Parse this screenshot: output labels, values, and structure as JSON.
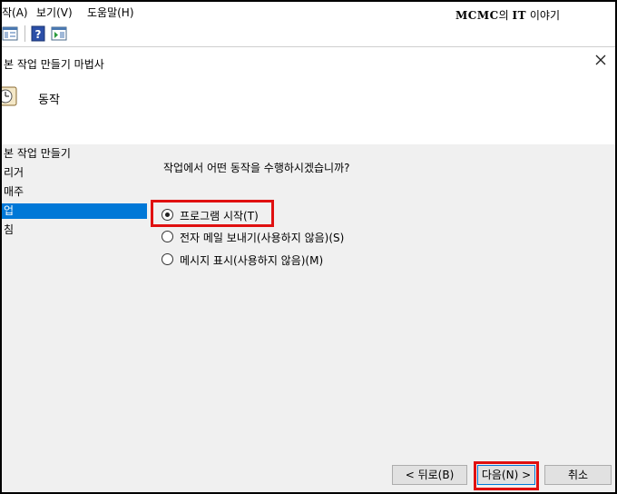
{
  "menubar": {
    "items": [
      "작(A)",
      "보기(V)",
      "도움말(H)"
    ]
  },
  "watermark": {
    "brand": "MCMC",
    "part1": "의 ",
    "bold": "IT",
    "part2": " 이야기"
  },
  "wizard": {
    "title": "본 작업 만들기 마법사",
    "step_heading": "동작",
    "steps": [
      "본 작업 만들기",
      "리거",
      " 매주",
      "업",
      "침"
    ],
    "active_step_index": 3,
    "question": "작업에서 어떤 동작을 수행하시겠습니까?",
    "options": [
      {
        "label": "프로그램 시작(T)",
        "checked": true
      },
      {
        "label": "전자 메일 보내기(사용하지 않음)(S)",
        "checked": false
      },
      {
        "label": "메시지 표시(사용하지 않음)(M)",
        "checked": false
      }
    ]
  },
  "buttons": {
    "back": "< 뒤로(B)",
    "next": "다음(N) >",
    "cancel": "취소"
  },
  "colors": {
    "highlight": "#e01010",
    "selection": "#0078d7"
  }
}
